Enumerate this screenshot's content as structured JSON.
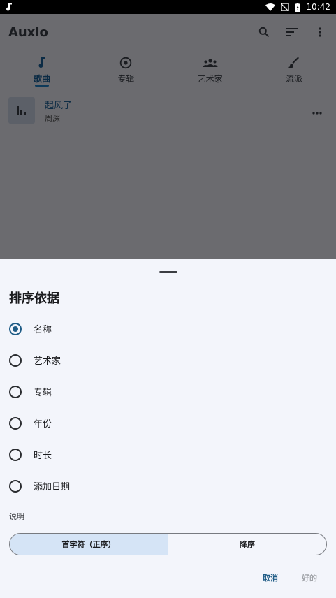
{
  "statusbar": {
    "time": "10:42"
  },
  "app": {
    "title": "Auxio",
    "tabs": [
      {
        "label": "歌曲",
        "icon": "music-note-icon",
        "active": true
      },
      {
        "label": "专辑",
        "icon": "album-icon",
        "active": false
      },
      {
        "label": "艺术家",
        "icon": "people-icon",
        "active": false
      },
      {
        "label": "流派",
        "icon": "brush-icon",
        "active": false
      }
    ],
    "songs": [
      {
        "title": "起风了",
        "artist": "周深"
      }
    ]
  },
  "sheet": {
    "title": "排序依据",
    "options": [
      {
        "label": "名称",
        "checked": true
      },
      {
        "label": "艺术家",
        "checked": false
      },
      {
        "label": "专辑",
        "checked": false
      },
      {
        "label": "年份",
        "checked": false
      },
      {
        "label": "时长",
        "checked": false
      },
      {
        "label": "添加日期",
        "checked": false
      }
    ],
    "section_label": "说明",
    "toggle": {
      "ascending": "首字符（正序）",
      "descending": "降序"
    },
    "cancel": "取消",
    "ok": "好的"
  },
  "colors": {
    "accent": "#1f5c86",
    "scrim": "#6b6b6f",
    "sheet_bg": "#f3f5fb",
    "selected_toggle": "#d5e4f6"
  }
}
